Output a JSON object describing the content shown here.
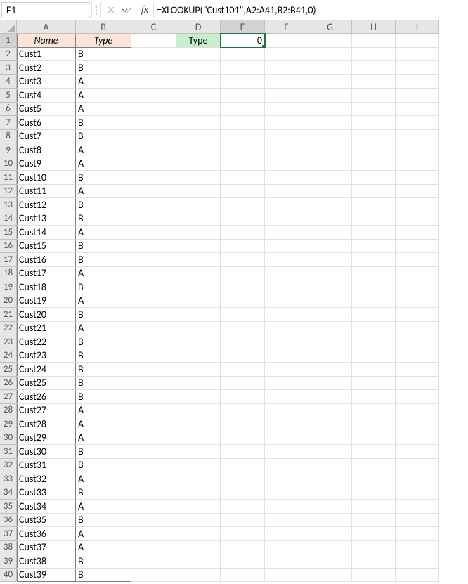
{
  "nameBox": "E1",
  "formula": "=XLOOKUP(\"Cust101\",A2:A41,B2:B41,0)",
  "columns": [
    "A",
    "B",
    "C",
    "D",
    "E",
    "F",
    "G",
    "H",
    "I"
  ],
  "selectedCol": "E",
  "selectedRow": 1,
  "headers": {
    "A": "Name",
    "B": "Type"
  },
  "d1": {
    "label": "Type"
  },
  "e1": {
    "value": "0"
  },
  "rows": [
    {
      "n": 1,
      "name": "",
      "type": ""
    },
    {
      "n": 2,
      "name": "Cust1",
      "type": "B"
    },
    {
      "n": 3,
      "name": "Cust2",
      "type": "B"
    },
    {
      "n": 4,
      "name": "Cust3",
      "type": "A"
    },
    {
      "n": 5,
      "name": "Cust4",
      "type": "A"
    },
    {
      "n": 6,
      "name": "Cust5",
      "type": "A"
    },
    {
      "n": 7,
      "name": "Cust6",
      "type": "B"
    },
    {
      "n": 8,
      "name": "Cust7",
      "type": "B"
    },
    {
      "n": 9,
      "name": "Cust8",
      "type": "A"
    },
    {
      "n": 10,
      "name": "Cust9",
      "type": "A"
    },
    {
      "n": 11,
      "name": "Cust10",
      "type": "B"
    },
    {
      "n": 12,
      "name": "Cust11",
      "type": "A"
    },
    {
      "n": 13,
      "name": "Cust12",
      "type": "B"
    },
    {
      "n": 14,
      "name": "Cust13",
      "type": "B"
    },
    {
      "n": 15,
      "name": "Cust14",
      "type": "A"
    },
    {
      "n": 16,
      "name": "Cust15",
      "type": "B"
    },
    {
      "n": 17,
      "name": "Cust16",
      "type": "B"
    },
    {
      "n": 18,
      "name": "Cust17",
      "type": "A"
    },
    {
      "n": 19,
      "name": "Cust18",
      "type": "B"
    },
    {
      "n": 20,
      "name": "Cust19",
      "type": "A"
    },
    {
      "n": 21,
      "name": "Cust20",
      "type": "B"
    },
    {
      "n": 22,
      "name": "Cust21",
      "type": "A"
    },
    {
      "n": 23,
      "name": "Cust22",
      "type": "B"
    },
    {
      "n": 24,
      "name": "Cust23",
      "type": "B"
    },
    {
      "n": 25,
      "name": "Cust24",
      "type": "B"
    },
    {
      "n": 26,
      "name": "Cust25",
      "type": "B"
    },
    {
      "n": 27,
      "name": "Cust26",
      "type": "B"
    },
    {
      "n": 28,
      "name": "Cust27",
      "type": "A"
    },
    {
      "n": 29,
      "name": "Cust28",
      "type": "A"
    },
    {
      "n": 30,
      "name": "Cust29",
      "type": "A"
    },
    {
      "n": 31,
      "name": "Cust30",
      "type": "B"
    },
    {
      "n": 32,
      "name": "Cust31",
      "type": "B"
    },
    {
      "n": 33,
      "name": "Cust32",
      "type": "A"
    },
    {
      "n": 34,
      "name": "Cust33",
      "type": "B"
    },
    {
      "n": 35,
      "name": "Cust34",
      "type": "A"
    },
    {
      "n": 36,
      "name": "Cust35",
      "type": "B"
    },
    {
      "n": 37,
      "name": "Cust36",
      "type": "A"
    },
    {
      "n": 38,
      "name": "Cust37",
      "type": "A"
    },
    {
      "n": 39,
      "name": "Cust38",
      "type": "B"
    },
    {
      "n": 40,
      "name": "Cust39",
      "type": "B"
    }
  ]
}
